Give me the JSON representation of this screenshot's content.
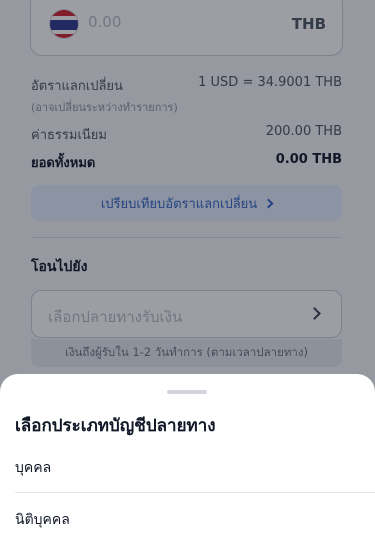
{
  "amount": {
    "placeholder": "0.00",
    "currency": "THB",
    "flag": "thailand-flag-icon"
  },
  "rates": {
    "exchange_label": "อัตราแลกเปลี่ยน",
    "exchange_value": "1 USD = 34.9001 THB",
    "exchange_note": "(อาจเปลี่ยนระหว่างทำรายการ)",
    "fee_label": "ค่าธรรมเนียม",
    "fee_value": "200.00 THB",
    "total_label": "ยอดทั้งหมด",
    "total_value": "0.00 THB"
  },
  "compare_button": "เปรียบเทียบอัตราแลกเปลี่ยน",
  "transfer": {
    "section_title": "โอนไปยัง",
    "destination_placeholder": "เลือกปลายทางรับเงิน",
    "hint": "เงินถึงผู้รับใน 1-2 วันทำการ (ตามเวลาปลายทาง)"
  },
  "sheet": {
    "title": "เลือกประเภทบัญชีปลายทาง",
    "options": [
      "บุคคล",
      "นิติบุคคล"
    ]
  }
}
